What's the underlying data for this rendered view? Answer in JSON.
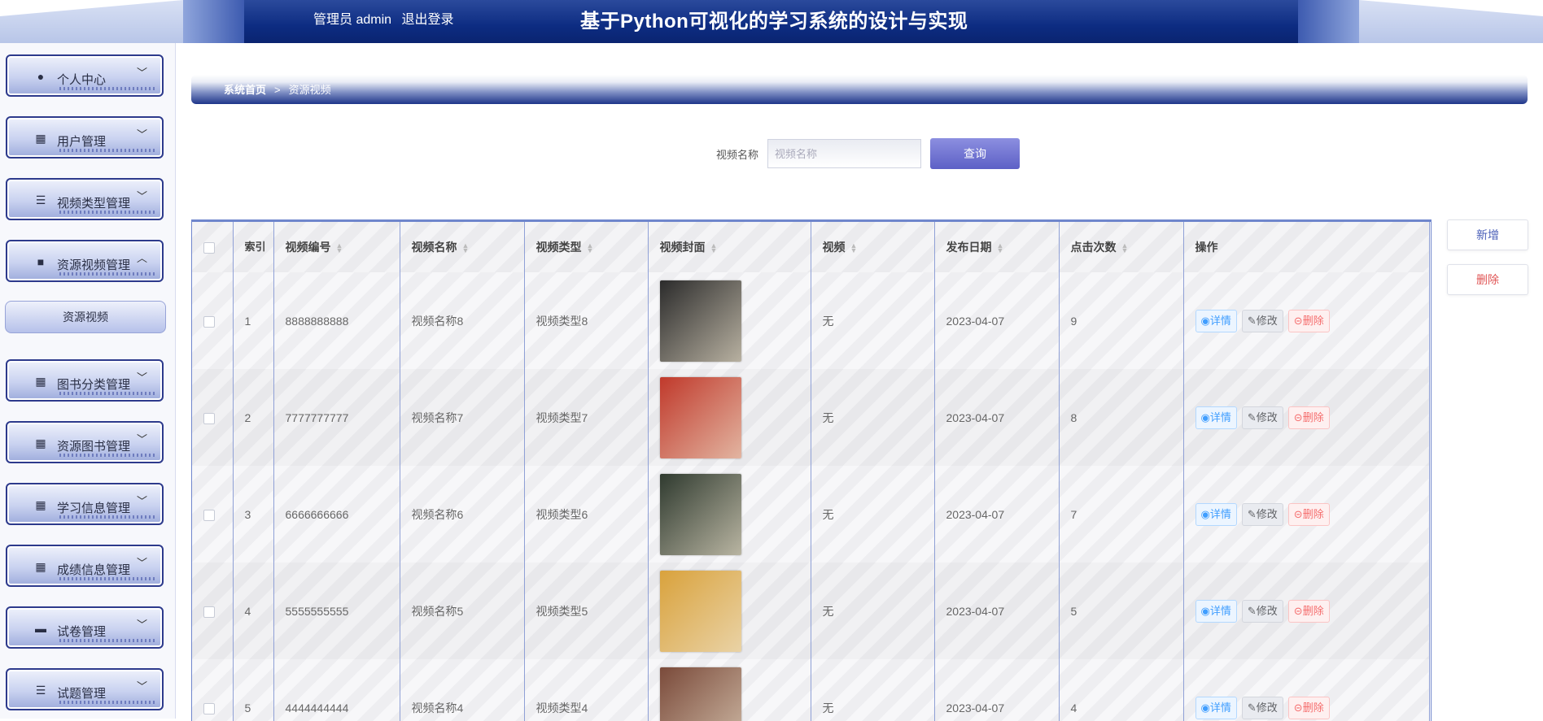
{
  "header": {
    "user_label": "管理员 admin",
    "logout_label": "退出登录",
    "title": "基于Python可视化的学习系统的设计与实现"
  },
  "sidebar": {
    "items": [
      {
        "label": "个人中心",
        "icon": "user-icon",
        "arrow": "﹀"
      },
      {
        "label": "用户管理",
        "icon": "grid-icon",
        "arrow": "﹀"
      },
      {
        "label": "视频类型管理",
        "icon": "list-icon",
        "arrow": "﹀"
      },
      {
        "label": "资源视频管理",
        "icon": "video-icon",
        "arrow": "︿"
      },
      {
        "label": "图书分类管理",
        "icon": "grid-icon",
        "arrow": "﹀"
      },
      {
        "label": "资源图书管理",
        "icon": "grid-icon",
        "arrow": "﹀"
      },
      {
        "label": "学习信息管理",
        "icon": "grid-icon",
        "arrow": "﹀"
      },
      {
        "label": "成绩信息管理",
        "icon": "apps-icon",
        "arrow": "﹀"
      },
      {
        "label": "试卷管理",
        "icon": "monitor-icon",
        "arrow": "﹀"
      },
      {
        "label": "试题管理",
        "icon": "sliders-icon",
        "arrow": "﹀"
      }
    ],
    "submenu_label": "资源视频"
  },
  "breadcrumb": {
    "home": "系统首页",
    "separator": ">",
    "current": "资源视频"
  },
  "search": {
    "label": "视频名称",
    "placeholder": "视频名称",
    "button": "查询"
  },
  "actions": {
    "add": "新增",
    "delete": "删除"
  },
  "table": {
    "headers": {
      "index": "索引",
      "video_no": "视频编号",
      "video_name": "视频名称",
      "video_type": "视频类型",
      "cover": "视频封面",
      "video": "视频",
      "publish_date": "发布日期",
      "clicks": "点击次数",
      "ops": "操作"
    },
    "op_labels": {
      "detail": "详情",
      "edit": "修改",
      "delete": "删除"
    },
    "rows": [
      {
        "index": "1",
        "video_no": "8888888888",
        "video_name": "视频名称8",
        "video_type": "视频类型8",
        "video": "无",
        "publish_date": "2023-04-07",
        "clicks": "9",
        "cover_color": "#2b2b2b"
      },
      {
        "index": "2",
        "video_no": "7777777777",
        "video_name": "视频名称7",
        "video_type": "视频类型7",
        "video": "无",
        "publish_date": "2023-04-07",
        "clicks": "8",
        "cover_color": "#c0392b"
      },
      {
        "index": "3",
        "video_no": "6666666666",
        "video_name": "视频名称6",
        "video_type": "视频类型6",
        "video": "无",
        "publish_date": "2023-04-07",
        "clicks": "7",
        "cover_color": "#2f3a2f"
      },
      {
        "index": "4",
        "video_no": "5555555555",
        "video_name": "视频名称5",
        "video_type": "视频类型5",
        "video": "无",
        "publish_date": "2023-04-07",
        "clicks": "5",
        "cover_color": "#d9a23c"
      },
      {
        "index": "5",
        "video_no": "4444444444",
        "video_name": "视频名称4",
        "video_type": "视频类型4",
        "video": "无",
        "publish_date": "2023-04-07",
        "clicks": "4",
        "cover_color": "#7a4a3a"
      }
    ]
  },
  "colors": {
    "header_band": "#0d2c82",
    "accent": "#5d60c6",
    "detail": "#409eff",
    "danger": "#f56c6c"
  }
}
